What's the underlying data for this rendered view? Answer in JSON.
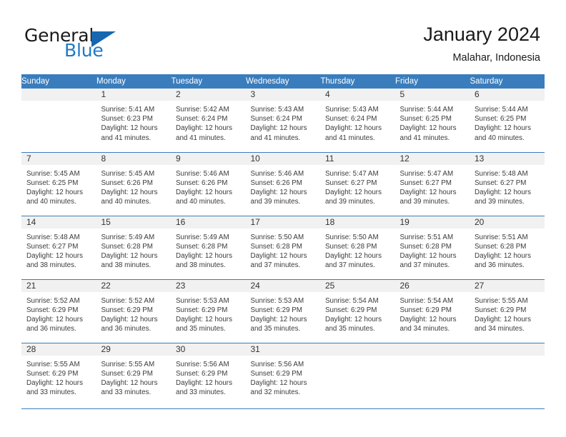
{
  "brand": {
    "name_part1": "General",
    "name_part2": "Blue",
    "logo_triangle_color": "#1667b0",
    "blue_text_color": "#2079c4"
  },
  "header": {
    "title": "January 2024",
    "subtitle": "Malahar, Indonesia"
  },
  "theme": {
    "header_row_bg": "#3a7dbd",
    "header_row_text": "#ffffff",
    "day_number_bg": "#f1f1f1",
    "grid_line": "#3a7dbd",
    "body_text": "#3b3b3b"
  },
  "weekday_headers": [
    "Sunday",
    "Monday",
    "Tuesday",
    "Wednesday",
    "Thursday",
    "Friday",
    "Saturday"
  ],
  "weeks": [
    [
      {
        "day": "",
        "sunrise": "",
        "sunset": "",
        "daylight_line1": "",
        "daylight_line2": "",
        "empty": true
      },
      {
        "day": "1",
        "sunrise": "Sunrise: 5:41 AM",
        "sunset": "Sunset: 6:23 PM",
        "daylight_line1": "Daylight: 12 hours",
        "daylight_line2": "and 41 minutes.",
        "empty": false
      },
      {
        "day": "2",
        "sunrise": "Sunrise: 5:42 AM",
        "sunset": "Sunset: 6:24 PM",
        "daylight_line1": "Daylight: 12 hours",
        "daylight_line2": "and 41 minutes.",
        "empty": false
      },
      {
        "day": "3",
        "sunrise": "Sunrise: 5:43 AM",
        "sunset": "Sunset: 6:24 PM",
        "daylight_line1": "Daylight: 12 hours",
        "daylight_line2": "and 41 minutes.",
        "empty": false
      },
      {
        "day": "4",
        "sunrise": "Sunrise: 5:43 AM",
        "sunset": "Sunset: 6:24 PM",
        "daylight_line1": "Daylight: 12 hours",
        "daylight_line2": "and 41 minutes.",
        "empty": false
      },
      {
        "day": "5",
        "sunrise": "Sunrise: 5:44 AM",
        "sunset": "Sunset: 6:25 PM",
        "daylight_line1": "Daylight: 12 hours",
        "daylight_line2": "and 41 minutes.",
        "empty": false
      },
      {
        "day": "6",
        "sunrise": "Sunrise: 5:44 AM",
        "sunset": "Sunset: 6:25 PM",
        "daylight_line1": "Daylight: 12 hours",
        "daylight_line2": "and 40 minutes.",
        "empty": false
      }
    ],
    [
      {
        "day": "7",
        "sunrise": "Sunrise: 5:45 AM",
        "sunset": "Sunset: 6:25 PM",
        "daylight_line1": "Daylight: 12 hours",
        "daylight_line2": "and 40 minutes.",
        "empty": false
      },
      {
        "day": "8",
        "sunrise": "Sunrise: 5:45 AM",
        "sunset": "Sunset: 6:26 PM",
        "daylight_line1": "Daylight: 12 hours",
        "daylight_line2": "and 40 minutes.",
        "empty": false
      },
      {
        "day": "9",
        "sunrise": "Sunrise: 5:46 AM",
        "sunset": "Sunset: 6:26 PM",
        "daylight_line1": "Daylight: 12 hours",
        "daylight_line2": "and 40 minutes.",
        "empty": false
      },
      {
        "day": "10",
        "sunrise": "Sunrise: 5:46 AM",
        "sunset": "Sunset: 6:26 PM",
        "daylight_line1": "Daylight: 12 hours",
        "daylight_line2": "and 39 minutes.",
        "empty": false
      },
      {
        "day": "11",
        "sunrise": "Sunrise: 5:47 AM",
        "sunset": "Sunset: 6:27 PM",
        "daylight_line1": "Daylight: 12 hours",
        "daylight_line2": "and 39 minutes.",
        "empty": false
      },
      {
        "day": "12",
        "sunrise": "Sunrise: 5:47 AM",
        "sunset": "Sunset: 6:27 PM",
        "daylight_line1": "Daylight: 12 hours",
        "daylight_line2": "and 39 minutes.",
        "empty": false
      },
      {
        "day": "13",
        "sunrise": "Sunrise: 5:48 AM",
        "sunset": "Sunset: 6:27 PM",
        "daylight_line1": "Daylight: 12 hours",
        "daylight_line2": "and 39 minutes.",
        "empty": false
      }
    ],
    [
      {
        "day": "14",
        "sunrise": "Sunrise: 5:48 AM",
        "sunset": "Sunset: 6:27 PM",
        "daylight_line1": "Daylight: 12 hours",
        "daylight_line2": "and 38 minutes.",
        "empty": false
      },
      {
        "day": "15",
        "sunrise": "Sunrise: 5:49 AM",
        "sunset": "Sunset: 6:28 PM",
        "daylight_line1": "Daylight: 12 hours",
        "daylight_line2": "and 38 minutes.",
        "empty": false
      },
      {
        "day": "16",
        "sunrise": "Sunrise: 5:49 AM",
        "sunset": "Sunset: 6:28 PM",
        "daylight_line1": "Daylight: 12 hours",
        "daylight_line2": "and 38 minutes.",
        "empty": false
      },
      {
        "day": "17",
        "sunrise": "Sunrise: 5:50 AM",
        "sunset": "Sunset: 6:28 PM",
        "daylight_line1": "Daylight: 12 hours",
        "daylight_line2": "and 37 minutes.",
        "empty": false
      },
      {
        "day": "18",
        "sunrise": "Sunrise: 5:50 AM",
        "sunset": "Sunset: 6:28 PM",
        "daylight_line1": "Daylight: 12 hours",
        "daylight_line2": "and 37 minutes.",
        "empty": false
      },
      {
        "day": "19",
        "sunrise": "Sunrise: 5:51 AM",
        "sunset": "Sunset: 6:28 PM",
        "daylight_line1": "Daylight: 12 hours",
        "daylight_line2": "and 37 minutes.",
        "empty": false
      },
      {
        "day": "20",
        "sunrise": "Sunrise: 5:51 AM",
        "sunset": "Sunset: 6:28 PM",
        "daylight_line1": "Daylight: 12 hours",
        "daylight_line2": "and 36 minutes.",
        "empty": false
      }
    ],
    [
      {
        "day": "21",
        "sunrise": "Sunrise: 5:52 AM",
        "sunset": "Sunset: 6:29 PM",
        "daylight_line1": "Daylight: 12 hours",
        "daylight_line2": "and 36 minutes.",
        "empty": false
      },
      {
        "day": "22",
        "sunrise": "Sunrise: 5:52 AM",
        "sunset": "Sunset: 6:29 PM",
        "daylight_line1": "Daylight: 12 hours",
        "daylight_line2": "and 36 minutes.",
        "empty": false
      },
      {
        "day": "23",
        "sunrise": "Sunrise: 5:53 AM",
        "sunset": "Sunset: 6:29 PM",
        "daylight_line1": "Daylight: 12 hours",
        "daylight_line2": "and 35 minutes.",
        "empty": false
      },
      {
        "day": "24",
        "sunrise": "Sunrise: 5:53 AM",
        "sunset": "Sunset: 6:29 PM",
        "daylight_line1": "Daylight: 12 hours",
        "daylight_line2": "and 35 minutes.",
        "empty": false
      },
      {
        "day": "25",
        "sunrise": "Sunrise: 5:54 AM",
        "sunset": "Sunset: 6:29 PM",
        "daylight_line1": "Daylight: 12 hours",
        "daylight_line2": "and 35 minutes.",
        "empty": false
      },
      {
        "day": "26",
        "sunrise": "Sunrise: 5:54 AM",
        "sunset": "Sunset: 6:29 PM",
        "daylight_line1": "Daylight: 12 hours",
        "daylight_line2": "and 34 minutes.",
        "empty": false
      },
      {
        "day": "27",
        "sunrise": "Sunrise: 5:55 AM",
        "sunset": "Sunset: 6:29 PM",
        "daylight_line1": "Daylight: 12 hours",
        "daylight_line2": "and 34 minutes.",
        "empty": false
      }
    ],
    [
      {
        "day": "28",
        "sunrise": "Sunrise: 5:55 AM",
        "sunset": "Sunset: 6:29 PM",
        "daylight_line1": "Daylight: 12 hours",
        "daylight_line2": "and 33 minutes.",
        "empty": false
      },
      {
        "day": "29",
        "sunrise": "Sunrise: 5:55 AM",
        "sunset": "Sunset: 6:29 PM",
        "daylight_line1": "Daylight: 12 hours",
        "daylight_line2": "and 33 minutes.",
        "empty": false
      },
      {
        "day": "30",
        "sunrise": "Sunrise: 5:56 AM",
        "sunset": "Sunset: 6:29 PM",
        "daylight_line1": "Daylight: 12 hours",
        "daylight_line2": "and 33 minutes.",
        "empty": false
      },
      {
        "day": "31",
        "sunrise": "Sunrise: 5:56 AM",
        "sunset": "Sunset: 6:29 PM",
        "daylight_line1": "Daylight: 12 hours",
        "daylight_line2": "and 32 minutes.",
        "empty": false
      },
      {
        "day": "",
        "sunrise": "",
        "sunset": "",
        "daylight_line1": "",
        "daylight_line2": "",
        "empty": true
      },
      {
        "day": "",
        "sunrise": "",
        "sunset": "",
        "daylight_line1": "",
        "daylight_line2": "",
        "empty": true
      },
      {
        "day": "",
        "sunrise": "",
        "sunset": "",
        "daylight_line1": "",
        "daylight_line2": "",
        "empty": true
      }
    ]
  ]
}
